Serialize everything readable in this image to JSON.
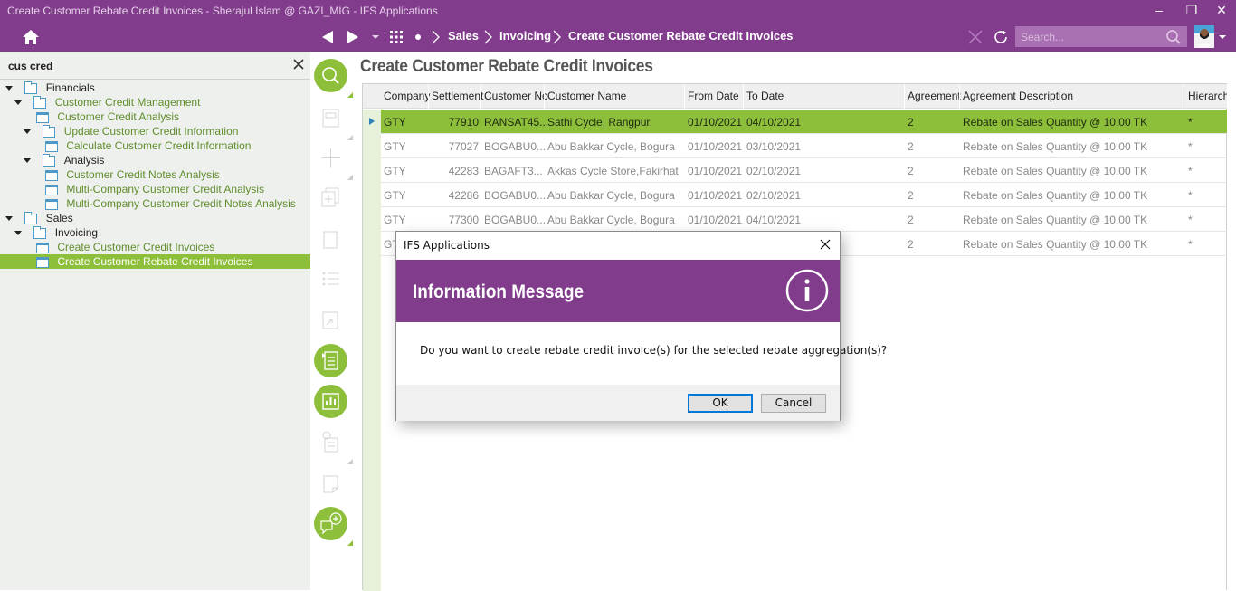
{
  "window": {
    "title": "Create Customer Rebate Credit Invoices - Sherajul Islam @ GAZI_MIG - IFS Applications",
    "controls": {
      "minimize": "–",
      "restore": "❐",
      "close": "✕"
    }
  },
  "navbar": {
    "icons": [
      "home-icon",
      "back-icon",
      "forward-icon",
      "dropdown-icon",
      "apps-grid-icon",
      "dot-icon"
    ],
    "breadcrumb": [
      "Sales",
      "Invoicing",
      "Create Customer Rebate Credit Invoices"
    ],
    "search_placeholder": "Search...",
    "colors": {
      "brand": "#813d8c",
      "accent": "#8dbf3a"
    }
  },
  "sidebar": {
    "search_value": "cus cred",
    "tree": [
      {
        "label": "Financials",
        "type": "folder",
        "level": 0,
        "expanded": true
      },
      {
        "label": "Customer Credit Management",
        "type": "folder",
        "level": 1,
        "expanded": true
      },
      {
        "label": "Customer Credit Analysis",
        "type": "window",
        "level": 2
      },
      {
        "label": "Update Customer Credit Information",
        "type": "folder",
        "level": 2,
        "expanded": true
      },
      {
        "label": "Calculate Customer Credit Information",
        "type": "assistant",
        "level": 3
      },
      {
        "label": "Analysis",
        "type": "folder",
        "level": 2,
        "expanded": true
      },
      {
        "label": "Customer Credit Notes Analysis",
        "type": "window",
        "level": 3
      },
      {
        "label": "Multi-Company Customer Credit Analysis",
        "type": "window",
        "level": 3
      },
      {
        "label": "Multi-Company Customer Credit Notes Analysis",
        "type": "window",
        "level": 3
      },
      {
        "label": "Sales",
        "type": "folder",
        "level": 0,
        "expanded": true
      },
      {
        "label": "Invoicing",
        "type": "folder",
        "level": 1,
        "expanded": true
      },
      {
        "label": "Create Customer Credit Invoices",
        "type": "window",
        "level": 2
      },
      {
        "label": "Create Customer Rebate Credit Invoices",
        "type": "window",
        "level": 2,
        "selected": true
      }
    ]
  },
  "toolrail": {
    "tools": [
      "search-icon",
      "edit-icon",
      "new-icon",
      "duplicate-icon",
      "delete-icon",
      "list-icon",
      "export-icon",
      "details-icon",
      "analysis-icon",
      "info-doc-icon",
      "note-icon",
      "chat-add-icon"
    ]
  },
  "main": {
    "page_title": "Create Customer Rebate Credit Invoices",
    "columns": [
      "Company",
      "Settlement",
      "Customer No",
      "Customer Name",
      "From Date",
      "To Date",
      "Agreement",
      "Agreement Description",
      "Hierarchy"
    ],
    "rows": [
      {
        "company": "GTY",
        "settlement": "77910",
        "customer_no": "RANSAT45...",
        "customer_name": "Sathi Cycle, Rangpur.",
        "from_date": "01/10/2021",
        "to_date": "04/10/2021",
        "agreement": "2",
        "agreement_desc": "Rebate on Sales Quantity @ 10.00 TK",
        "hierarchy": "*",
        "selected": true
      },
      {
        "company": "GTY",
        "settlement": "77027",
        "customer_no": "BOGABU0...",
        "customer_name": "Abu Bakkar Cycle, Bogura",
        "from_date": "01/10/2021",
        "to_date": "03/10/2021",
        "agreement": "2",
        "agreement_desc": "Rebate on Sales Quantity @ 10.00 TK",
        "hierarchy": "*"
      },
      {
        "company": "GTY",
        "settlement": "42283",
        "customer_no": "BAGAFT3...",
        "customer_name": "Akkas Cycle Store,Fakirhat",
        "from_date": "01/10/2021",
        "to_date": "02/10/2021",
        "agreement": "2",
        "agreement_desc": "Rebate on Sales Quantity @ 10.00 TK",
        "hierarchy": "*"
      },
      {
        "company": "GTY",
        "settlement": "42286",
        "customer_no": "BOGABU0...",
        "customer_name": "Abu Bakkar Cycle, Bogura",
        "from_date": "01/10/2021",
        "to_date": "02/10/2021",
        "agreement": "2",
        "agreement_desc": "Rebate on Sales Quantity @ 10.00 TK",
        "hierarchy": "*"
      },
      {
        "company": "GTY",
        "settlement": "77300",
        "customer_no": "BOGABU0...",
        "customer_name": "Abu Bakkar Cycle, Bogura",
        "from_date": "01/10/2021",
        "to_date": "04/10/2021",
        "agreement": "2",
        "agreement_desc": "Rebate on Sales Quantity @ 10.00 TK",
        "hierarchy": "*"
      },
      {
        "company": "GTY",
        "settlement": "",
        "customer_no": "",
        "customer_name": "",
        "from_date": "",
        "to_date": "",
        "agreement": "2",
        "agreement_desc": "Rebate on Sales Quantity @ 10.00 TK",
        "hierarchy": "*"
      }
    ]
  },
  "dialog": {
    "title": "IFS Applications",
    "heading": "Information Message",
    "message": "Do you want to create rebate credit invoice(s) for the selected rebate aggregation(s)?",
    "ok_label": "OK",
    "cancel_label": "Cancel"
  }
}
